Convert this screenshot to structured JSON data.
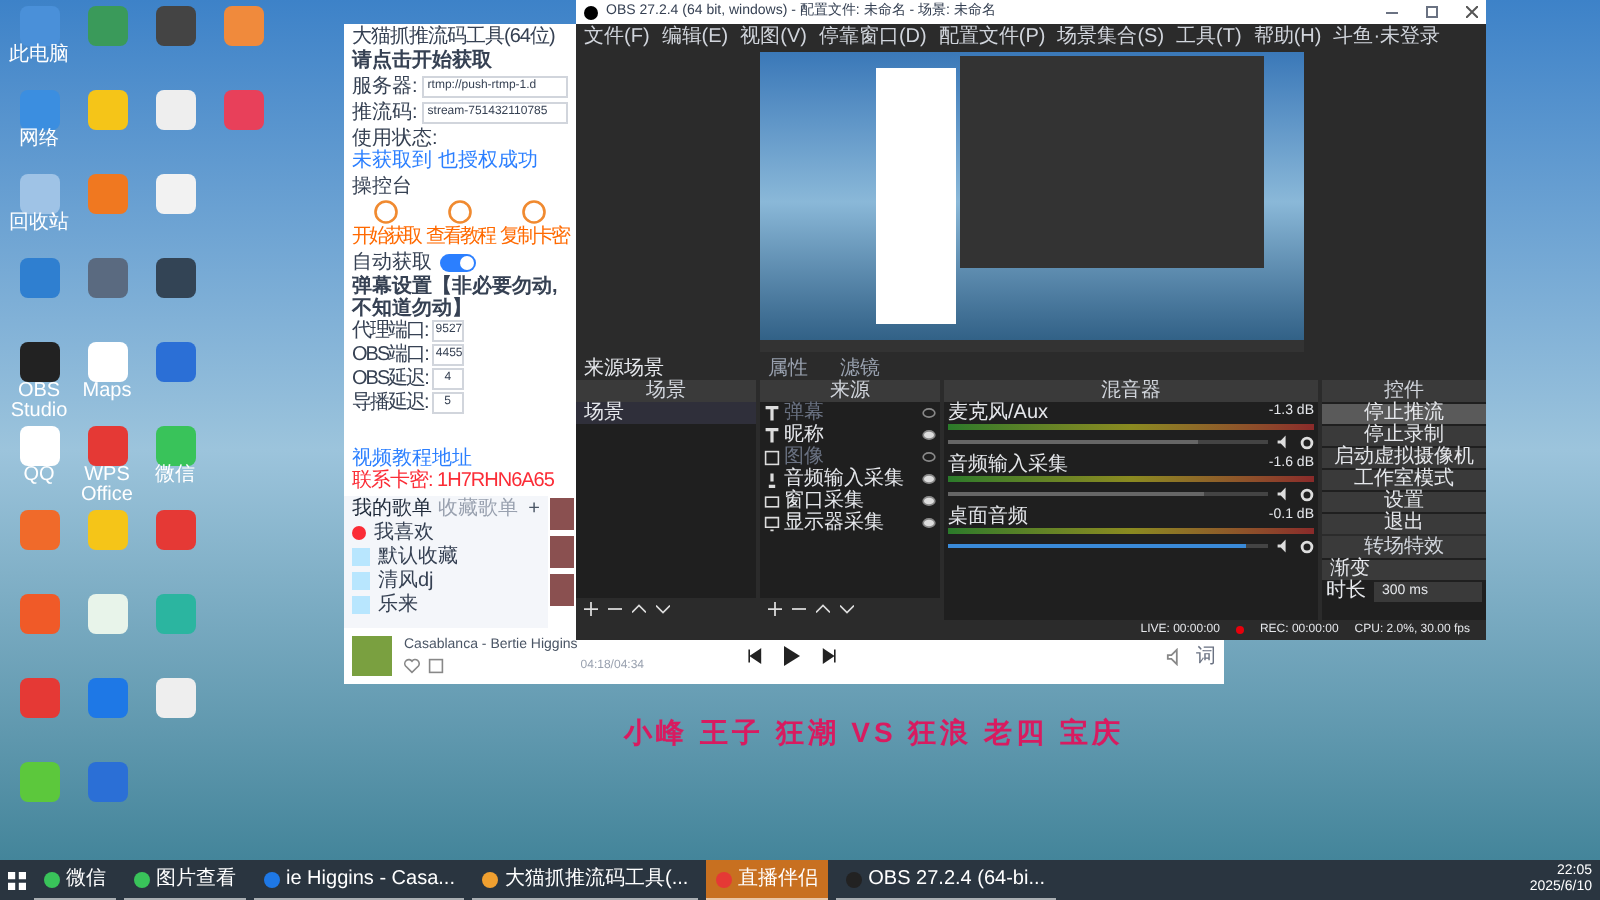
{
  "desktop_columns": [
    [
      {
        "label": "此电脑",
        "color": "#4a90d9"
      },
      {
        "label": "网络",
        "color": "#3b8ee0"
      },
      {
        "label": "回收站",
        "color": "#9fc3e6"
      },
      {
        "color": "#2f7fd0"
      },
      {
        "label": "OBS Studio",
        "color": "#222222"
      },
      {
        "label": "QQ",
        "color": "#ffffff"
      },
      {
        "color": "#f06a2a"
      },
      {
        "color": "#f05a28"
      },
      {
        "color": "#e53935"
      },
      {
        "color": "#5cc83c"
      }
    ],
    [
      {
        "color": "#3a9a5a"
      },
      {
        "color": "#f5c518"
      },
      {
        "color": "#f07820"
      },
      {
        "color": "#5a6a80"
      },
      {
        "label": "Maps",
        "color": "#ffffff"
      },
      {
        "label": "WPS Office",
        "color": "#e53935"
      },
      {
        "color": "#f5c518"
      },
      {
        "color": "#e8f4ea"
      },
      {
        "color": "#1e78e6"
      },
      {
        "color": "#2b6fd6"
      }
    ],
    [
      {
        "color": "#444444"
      },
      {
        "color": "#eeeeee"
      },
      {
        "color": "#f2f2f2"
      },
      {
        "color": "#334455"
      },
      {
        "color": "#2b6fd6"
      },
      {
        "label": "微信",
        "color": "#39c35a"
      },
      {
        "color": "#e53935"
      },
      {
        "color": "#2bb5a0"
      },
      {
        "color": "#eeeeee"
      }
    ],
    [
      {
        "color": "#f08a3c"
      },
      {
        "color": "#e8405a"
      }
    ]
  ],
  "tool_window": {
    "title": "大猫抓推流码工具(64位)",
    "section_1": "请点击开始获取",
    "fields": [
      {
        "label": "服务器:",
        "value": "rtmp://push-rtmp-1.d"
      },
      {
        "label": "推流码:",
        "value": "stream-751432110785"
      }
    ],
    "status_label": "使用状态:",
    "status_value": "未获取到 也授权成功",
    "section_2": "操控台",
    "actions": [
      "开始获取",
      "查看教程",
      "复制卡密"
    ],
    "auto_toggle": {
      "label": "自动获取",
      "on": true
    },
    "section_3": "弹幕设置【非必要勿动,不知道勿动】",
    "ports": [
      {
        "label": "代理端口:",
        "value": "9527"
      },
      {
        "label": "OBS端口:",
        "value": "4455"
      },
      {
        "label": "OBS延迟:",
        "value": "4"
      },
      {
        "label": "导播延迟:",
        "value": "5"
      }
    ],
    "footer_link": "视频教程地址",
    "footer_code": "联系卡密: 1H7RHN6A65"
  },
  "music": {
    "tabs": [
      {
        "label": "我的歌单",
        "selected": true
      },
      {
        "label": "收藏歌单",
        "selected": false
      }
    ],
    "add": "+",
    "playlists": [
      "我喜欢",
      "默认收藏",
      "清风dj",
      "乐来"
    ],
    "song": "Casablanca - Bertie Higgins",
    "time": "04:18/04:34",
    "lyrics_button": "词"
  },
  "obs": {
    "title": "OBS 27.2.4 (64 bit, windows) - 配置文件: 未命名 - 场景: 未命名",
    "menu": [
      "文件(F)",
      "编辑(E)",
      "视图(V)",
      "停靠窗口(D)",
      "配置文件(P)",
      "场景集合(S)",
      "工具(T)",
      "帮助(H)",
      "斗鱼·未登录"
    ],
    "source_bar": {
      "label": "来源场景",
      "buttons": [
        "属性",
        "滤镜"
      ]
    },
    "scenes": {
      "title": "场景",
      "items": [
        {
          "label": "场景",
          "selected": true
        }
      ]
    },
    "sources": {
      "title": "来源",
      "items": [
        {
          "label": "弹幕",
          "kind": "text",
          "visible": false
        },
        {
          "label": "昵称",
          "kind": "text",
          "visible": true
        },
        {
          "label": "图像",
          "kind": "image",
          "visible": false
        },
        {
          "label": "音频输入采集",
          "kind": "mic",
          "visible": true
        },
        {
          "label": "窗口采集",
          "kind": "window",
          "visible": true
        },
        {
          "label": "显示器采集",
          "kind": "monitor",
          "visible": true
        }
      ]
    },
    "mixer": {
      "title": "混音器",
      "channels": [
        {
          "name": "麦克风/Aux",
          "reading": "-1.3 dB",
          "level": 0.78
        },
        {
          "name": "音频输入采集",
          "reading": "-1.6 dB",
          "level": 0.8
        },
        {
          "name": "桌面音频",
          "reading": "-0.1 dB",
          "level": 0.93
        }
      ]
    },
    "controls": {
      "title": "控件",
      "buttons": [
        {
          "label": "停止推流",
          "selected": true
        },
        {
          "label": "停止录制",
          "selected": false
        },
        {
          "label": "启动虚拟摄像机",
          "selected": false
        },
        {
          "label": "工作室模式",
          "selected": false
        },
        {
          "label": "设置",
          "selected": false
        },
        {
          "label": "退出",
          "selected": false
        }
      ]
    },
    "transitions": {
      "title": "转场特效",
      "effect": "渐变",
      "duration_label": "时长",
      "duration": "300 ms"
    },
    "status": {
      "live": "LIVE: 00:00:00",
      "rec": "REC: 00:00:00",
      "cpu": "CPU: 2.0%, 30.00 fps"
    }
  },
  "overlay_text": "小峰 王子 狂潮 VS 狂浪 老四 宝庆",
  "taskbar": {
    "items": [
      {
        "label": "微信",
        "selected": false,
        "color": "#39c35a"
      },
      {
        "label": "图片查看",
        "selected": false,
        "color": "#39c35a"
      },
      {
        "label": "ie Higgins - Casa...",
        "selected": false,
        "color": "#1e78e6"
      },
      {
        "label": "大猫抓推流码工具(...",
        "selected": false,
        "color": "#f0a030"
      },
      {
        "label": "直播伴侣",
        "selected": true,
        "color": "#e53935"
      },
      {
        "label": "OBS 27.2.4 (64-bi...",
        "selected": false,
        "color": "#222222"
      }
    ],
    "time": "22:05",
    "date": "2025/6/10"
  }
}
